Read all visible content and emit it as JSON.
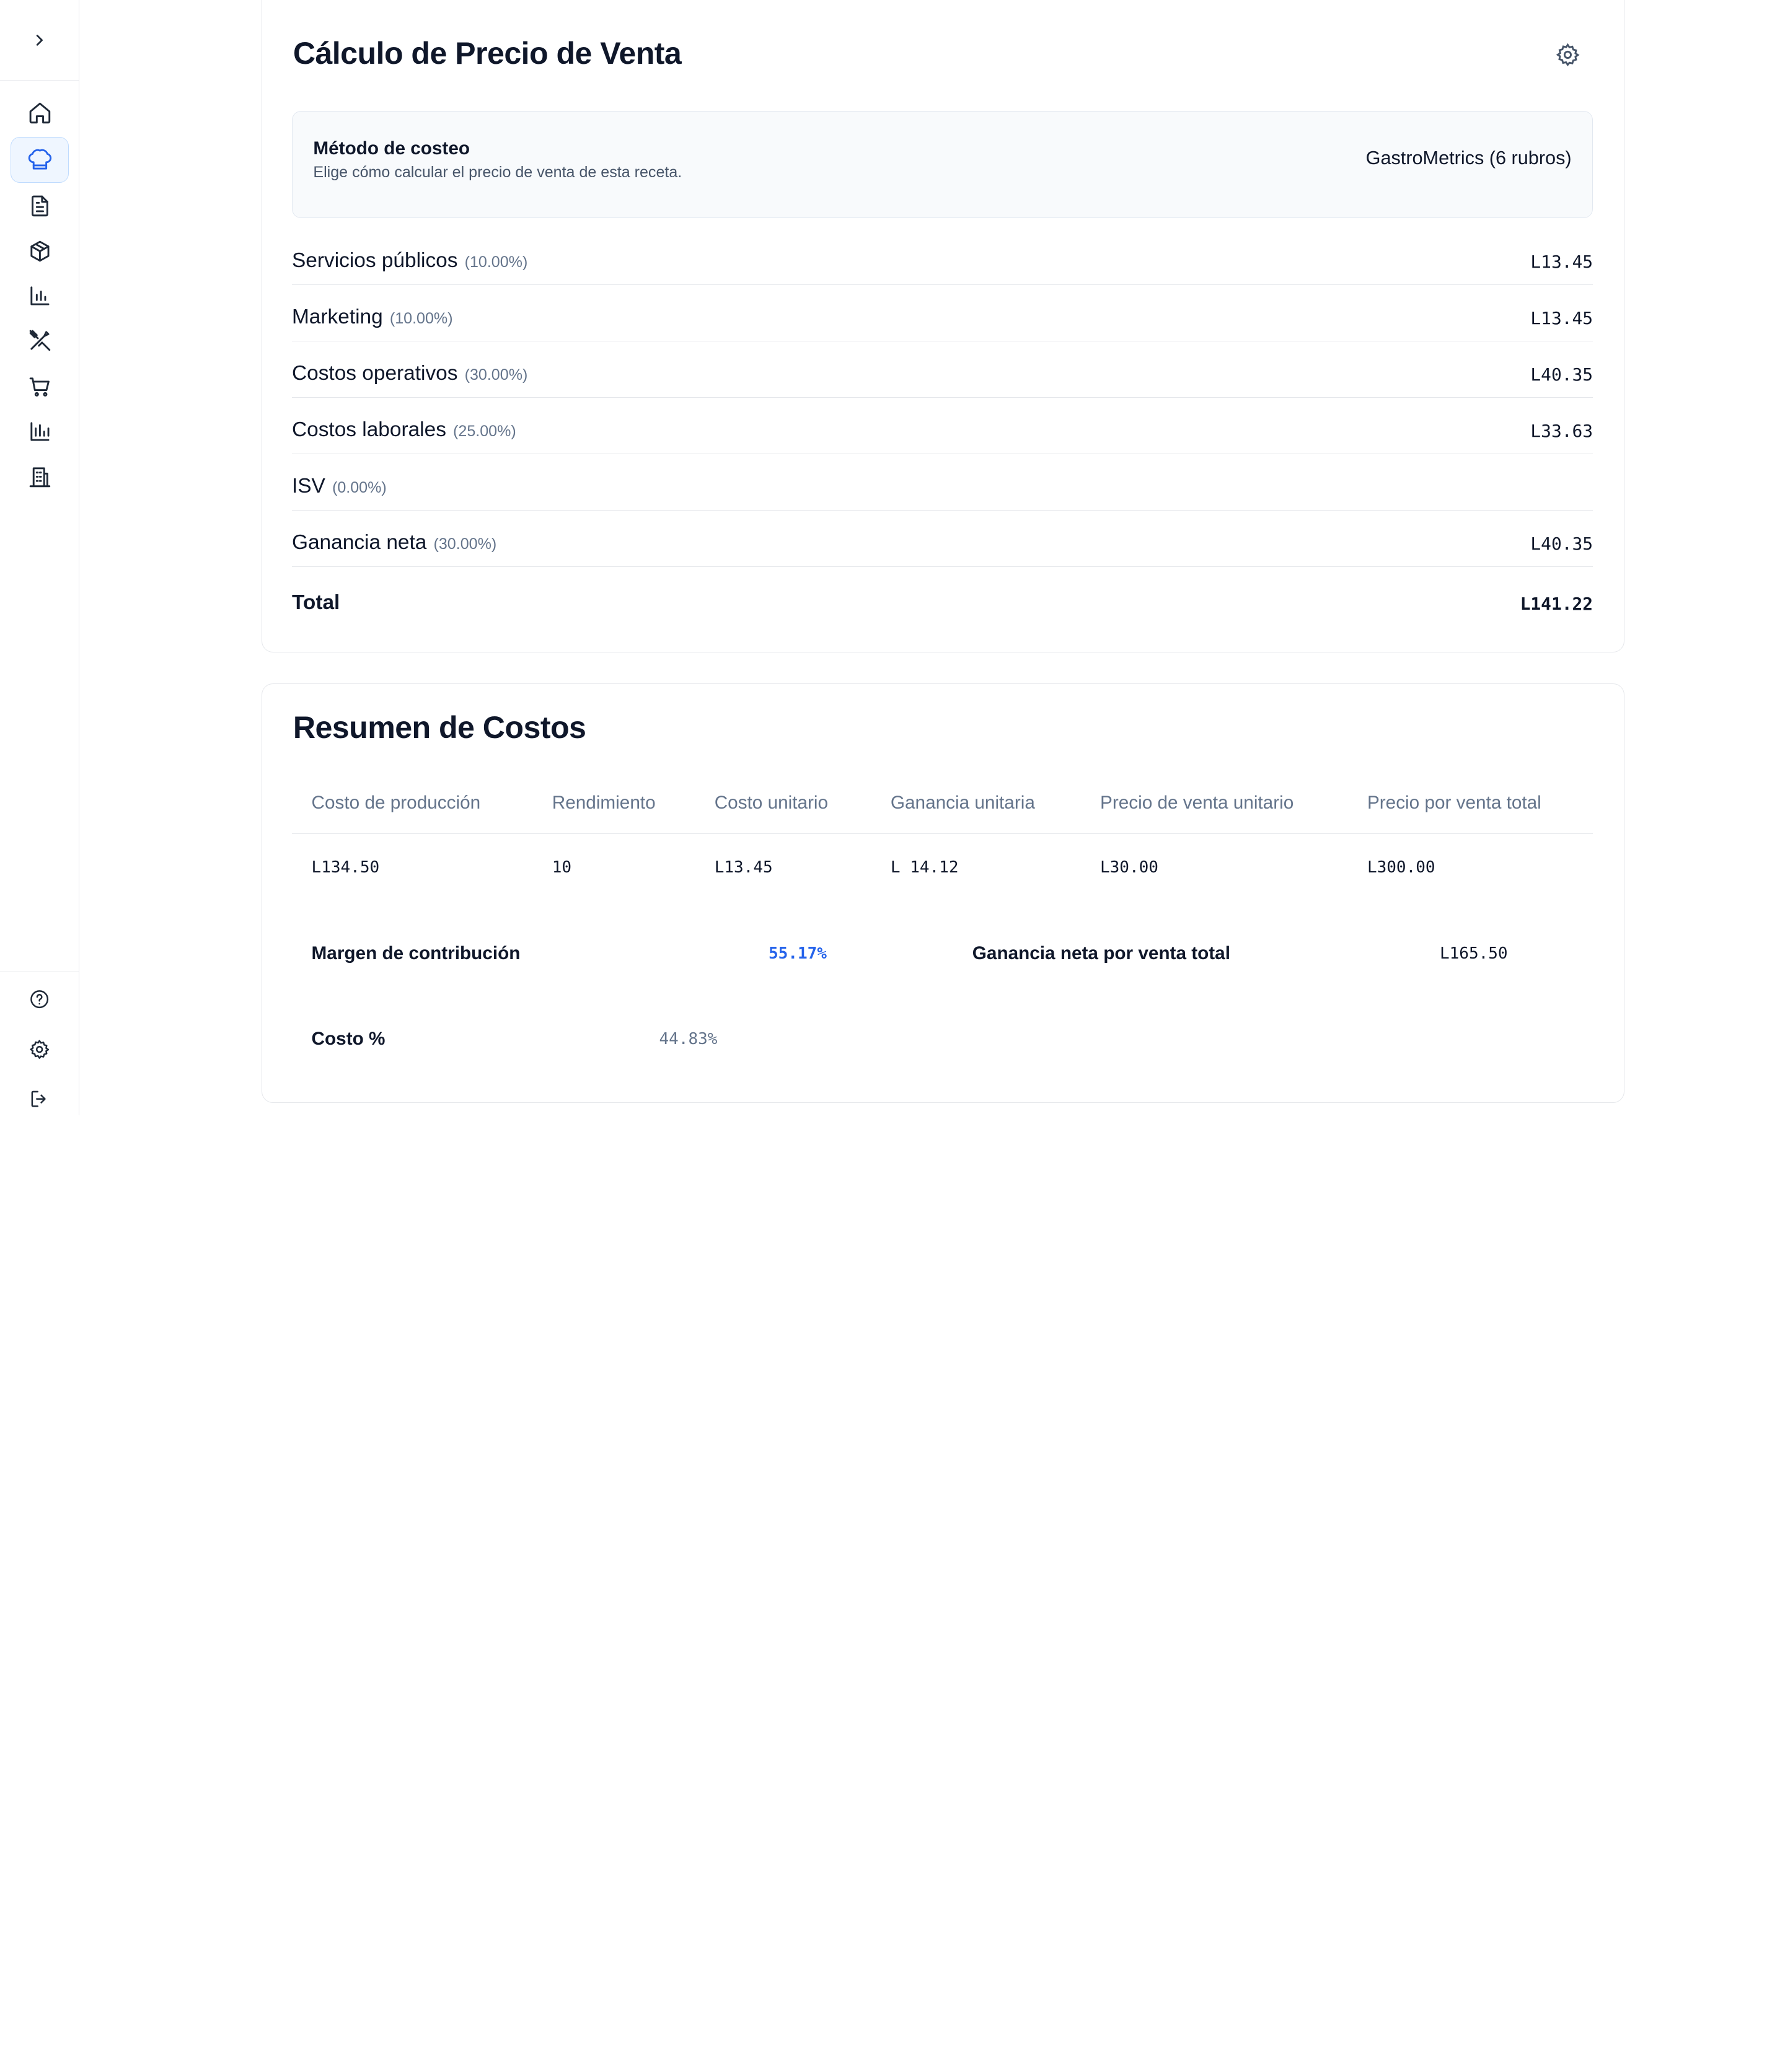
{
  "sidebar": {
    "toggle_icon": "chevron-right-icon",
    "items": [
      {
        "icon": "home-icon",
        "active": false
      },
      {
        "icon": "chef-hat-icon",
        "active": true
      },
      {
        "icon": "document-icon",
        "active": false
      },
      {
        "icon": "package-icon",
        "active": false
      },
      {
        "icon": "bar-chart-icon",
        "active": false
      },
      {
        "icon": "utensils-crossed-icon",
        "active": false
      },
      {
        "icon": "shopping-cart-icon",
        "active": false
      },
      {
        "icon": "bar-chart-2-icon",
        "active": false
      },
      {
        "icon": "building-icon",
        "active": false
      }
    ],
    "bottom": [
      {
        "icon": "help-circle-icon"
      },
      {
        "icon": "settings-icon"
      },
      {
        "icon": "logout-icon"
      }
    ]
  },
  "pricing": {
    "title": "Cálculo de Precio de Venta",
    "method": {
      "title": "Método de costeo",
      "subtitle": "Elige cómo calcular el precio de venta de esta receta.",
      "value": "GastroMetrics (6 rubros)"
    },
    "rows": [
      {
        "label": "Servicios públicos",
        "pct": "(10.00%)",
        "amount": "L13.45"
      },
      {
        "label": "Marketing",
        "pct": "(10.00%)",
        "amount": "L13.45"
      },
      {
        "label": "Costos operativos",
        "pct": "(30.00%)",
        "amount": "L40.35"
      },
      {
        "label": "Costos laborales",
        "pct": "(25.00%)",
        "amount": "L33.63"
      },
      {
        "label": "ISV",
        "pct": "(0.00%)",
        "amount": ""
      },
      {
        "label": "Ganancia neta",
        "pct": "(30.00%)",
        "amount": "L40.35"
      }
    ],
    "total_label": "Total",
    "total_amount": "L141.22"
  },
  "summary": {
    "title": "Resumen de Costos",
    "columns": [
      "Costo de producción",
      "Rendimiento",
      "Costo unitario",
      "Ganancia unitaria",
      "Precio de venta unitario",
      "Precio por venta total"
    ],
    "values": [
      "L134.50",
      "10",
      "L13.45",
      "L 14.12",
      "L30.00",
      "L300.00"
    ],
    "margin_label": "Margen de contribución",
    "margin_value": "55.17%",
    "net_profit_label": "Ganancia neta por venta total",
    "net_profit_value": "L165.50",
    "cost_pct_label": "Costo %",
    "cost_pct_value": "44.83%"
  },
  "colors": {
    "accent": "#2563eb",
    "muted": "#64748b",
    "border": "#e5e7eb"
  }
}
